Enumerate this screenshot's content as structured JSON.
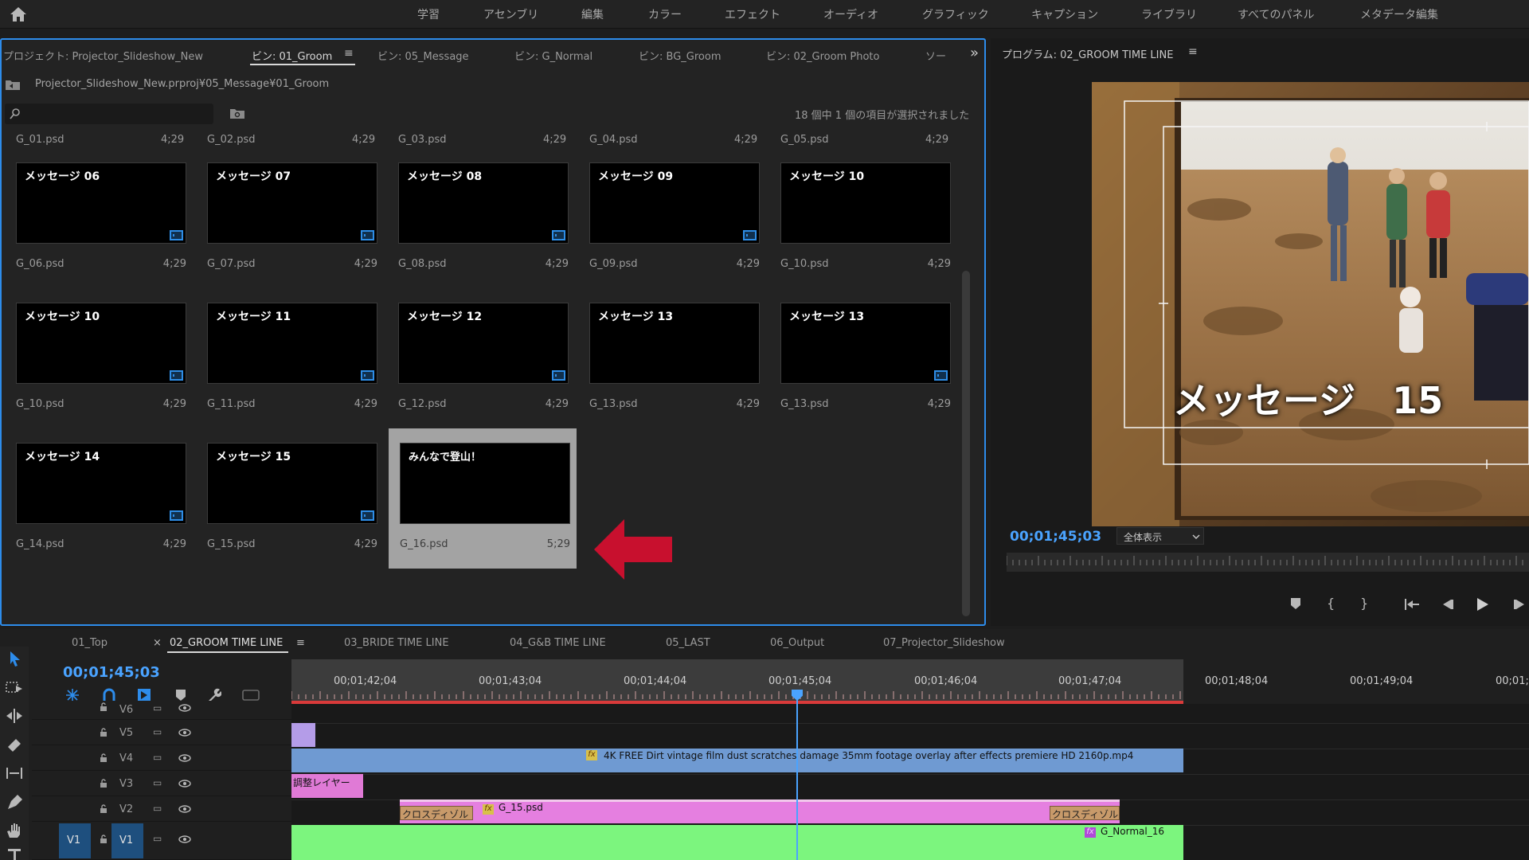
{
  "workspaces": [
    "学習",
    "アセンブリ",
    "編集",
    "カラー",
    "エフェクト",
    "オーディオ",
    "グラフィック",
    "キャプション",
    "ライブラリ",
    "すべてのパネル",
    "メタデータ編集"
  ],
  "project_panel": {
    "tabs": [
      "プロジェクト: Projector_Slideshow_New",
      "ビン: 01_Groom",
      "ビン: 05_Message",
      "ビン: G_Normal",
      "ビン: BG_Groom",
      "ビン: 02_Groom Photo",
      "ソー"
    ],
    "path": "Projector_Slideshow_New.prproj¥05_Message¥01_Groom",
    "selection_status": "18 個中 1 個の項目が選択されました",
    "top_row": [
      {
        "name": "G_01.psd",
        "dur": "4;29"
      },
      {
        "name": "G_02.psd",
        "dur": "4;29"
      },
      {
        "name": "G_03.psd",
        "dur": "4;29"
      },
      {
        "name": "G_04.psd",
        "dur": "4;29"
      },
      {
        "name": "G_05.psd",
        "dur": "4;29"
      }
    ],
    "items": [
      {
        "thumb": "メッセージ 06",
        "name": "G_06.psd",
        "dur": "4;29"
      },
      {
        "thumb": "メッセージ 07",
        "name": "G_07.psd",
        "dur": "4;29"
      },
      {
        "thumb": "メッセージ 08",
        "name": "G_08.psd",
        "dur": "4;29"
      },
      {
        "thumb": "メッセージ 09",
        "name": "G_09.psd",
        "dur": "4;29"
      },
      {
        "thumb": "メッセージ 10",
        "name": "G_10.psd",
        "dur": "4;29"
      },
      {
        "thumb": "メッセージ 10",
        "name": "G_10.psd",
        "dur": "4;29"
      },
      {
        "thumb": "メッセージ 11",
        "name": "G_11.psd",
        "dur": "4;29"
      },
      {
        "thumb": "メッセージ 12",
        "name": "G_12.psd",
        "dur": "4;29"
      },
      {
        "thumb": "メッセージ 13",
        "name": "G_13.psd",
        "dur": "4;29"
      },
      {
        "thumb": "メッセージ 13",
        "name": "G_13.psd",
        "dur": "4;29"
      },
      {
        "thumb": "メッセージ 14",
        "name": "G_14.psd",
        "dur": "4;29"
      },
      {
        "thumb": "メッセージ 15",
        "name": "G_15.psd",
        "dur": "4;29"
      },
      {
        "thumb": "みんなで登山！",
        "name": "G_16.psd",
        "dur": "5;29"
      }
    ]
  },
  "program_monitor": {
    "title": "プログラム: 02_GROOM TIME LINE",
    "overlay_text": "メッセージ　15",
    "timecode": "00;01;45;03",
    "zoom": "全体表示"
  },
  "timeline": {
    "tabs": [
      "01_Top",
      "02_GROOM TIME LINE",
      "03_BRIDE TIME LINE",
      "04_G&B TIME LINE",
      "05_LAST",
      "06_Output",
      "07_Projector_Slideshow"
    ],
    "timecode": "00;01;45;03",
    "ruler": [
      "00;01;42;04",
      "00;01;43;04",
      "00;01;44;04",
      "00;01;45;04",
      "00;01;46;04",
      "00;01;47;04",
      "00;01;48;04",
      "00;01;49;04",
      "00;01;"
    ],
    "tracks": [
      "V6",
      "V5",
      "V4",
      "V3",
      "V2",
      "V1"
    ],
    "source_patch": "V1",
    "clips": {
      "v4": "4K FREE Dirt vintage film dust scratches damage 35mm footage overlay after effects premiere HD 2160p.mp4",
      "v3": "調整レイヤー",
      "v2": "G_15.psd",
      "transition": "クロスディゾル",
      "v1": "G_Normal_16",
      "fx": "fx"
    }
  },
  "colors": {
    "accent_blue": "#2d8ceb",
    "red_arrow": "#c8102e",
    "clip_v4": "#6f9ad2",
    "clip_v3": "#e07ad6",
    "clip_v2": "#e57fe0",
    "clip_v1": "#7cf57e",
    "clip_v5": "#b49ce8"
  }
}
